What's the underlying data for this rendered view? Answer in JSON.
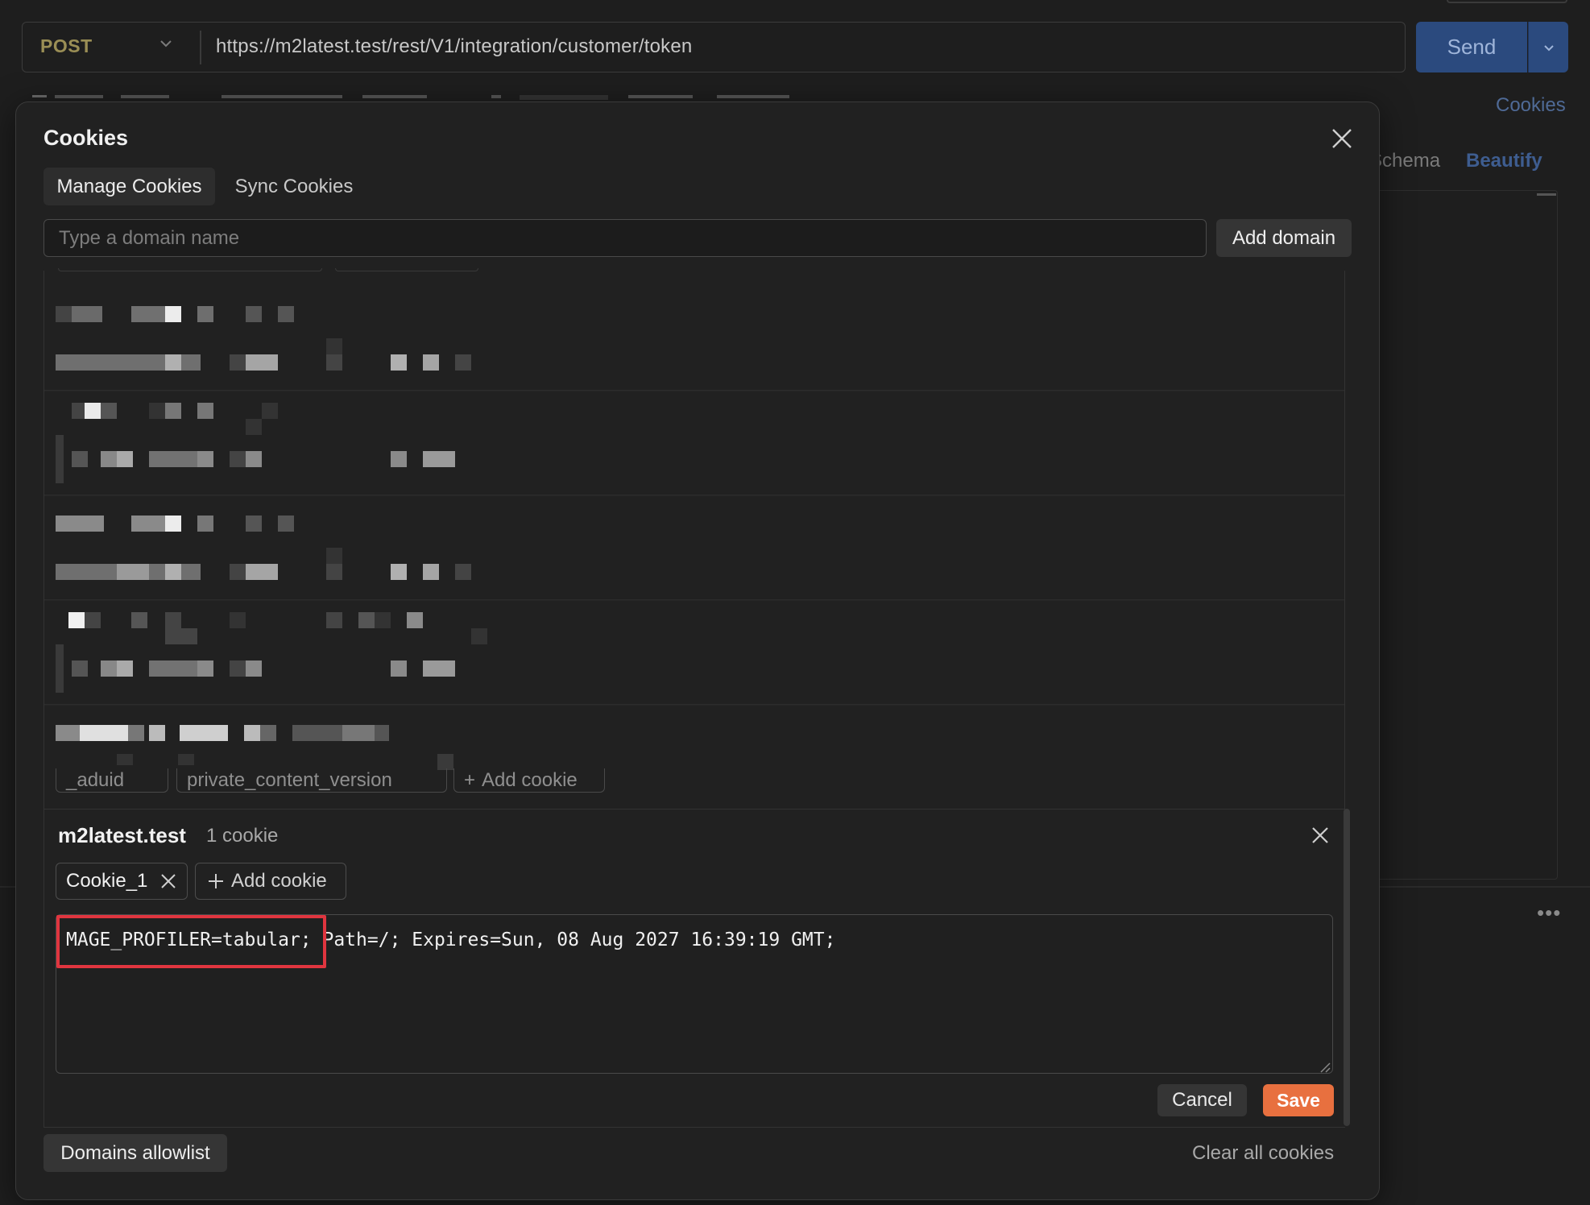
{
  "request": {
    "method": "POST",
    "url": "https://m2latest.test/rest/V1/integration/customer/token",
    "send_label": "Send",
    "cookies_link": "Cookies",
    "schema_label": "Schema",
    "beautify_label": "Beautify"
  },
  "modal": {
    "title": "Cookies",
    "tabs": [
      {
        "label": "Manage Cookies",
        "active": true
      },
      {
        "label": "Sync Cookies",
        "active": false
      }
    ],
    "domain_input": {
      "placeholder": "Type a domain name",
      "value": ""
    },
    "add_domain_label": "Add domain",
    "obscured_list_chips": [
      "_aduid",
      "private_content_version",
      "Add cookie"
    ],
    "domain": {
      "name": "m2latest.test",
      "count_label": "1 cookie",
      "cookies": [
        {
          "label": "Cookie_1"
        }
      ],
      "add_cookie_label": "Add cookie",
      "editor_highlight": "MAGE_PROFILER=tabular;",
      "editor_rest": " Path=/; Expires=Sun, 08 Aug 2027 16:39:19 GMT;",
      "cancel_label": "Cancel",
      "save_label": "Save"
    },
    "allowlist_label": "Domains allowlist",
    "clear_all_label": "Clear all cookies"
  },
  "colors": {
    "background": "#1e1e1e",
    "modal": "#212121",
    "send_button": "#2b4a7e",
    "save_button": "#e8703f",
    "highlight": "#e0353f",
    "link": "#4f6a96"
  },
  "icons": {
    "method_dropdown": "chevron-down-icon",
    "send_dropdown": "chevron-down-icon",
    "close": "close-icon",
    "add": "plus-icon",
    "remove_cookie": "close-icon",
    "more": "more-horizontal-icon",
    "resize": "resize-grip-icon"
  }
}
